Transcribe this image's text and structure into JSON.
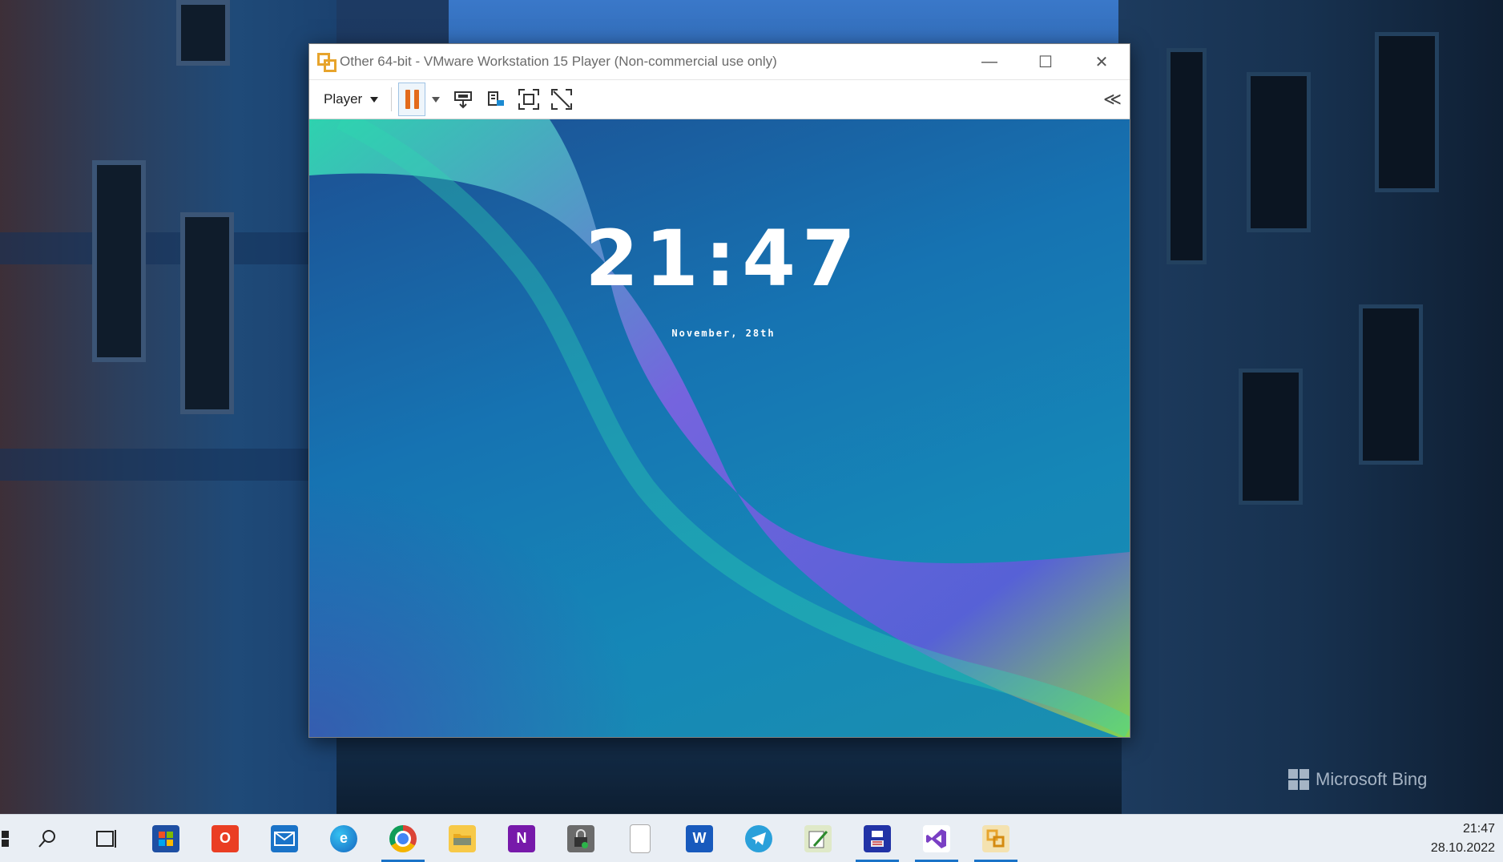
{
  "window": {
    "title": "Other 64-bit - VMware Workstation 15 Player (Non-commercial use only)",
    "controls": {
      "minimize": "—",
      "maximize": "☐",
      "close": "✕"
    }
  },
  "toolbar": {
    "player_label": "Player",
    "collapse_label": "≪",
    "icons": [
      "pause-icon",
      "send-ctrl-alt-del-icon",
      "removable-devices-icon",
      "full-screen-icon",
      "unity-icon"
    ]
  },
  "guest": {
    "clock": "21:47",
    "date": "November, 28th"
  },
  "desktop": {
    "watermark": "Microsoft Bing"
  },
  "taskbar": {
    "apps": [
      {
        "name": "start",
        "icon": "windows-start-icon",
        "active": false
      },
      {
        "name": "search",
        "icon": "search-icon",
        "active": false
      },
      {
        "name": "task-view",
        "icon": "task-view-icon",
        "active": false
      },
      {
        "name": "store",
        "icon": "microsoft-store-icon",
        "active": false
      },
      {
        "name": "office",
        "icon": "office-icon",
        "active": false
      },
      {
        "name": "mail",
        "icon": "mail-icon",
        "active": false
      },
      {
        "name": "edge",
        "icon": "edge-icon",
        "active": false
      },
      {
        "name": "chrome",
        "icon": "chrome-icon",
        "active": true
      },
      {
        "name": "file-explorer",
        "icon": "folder-icon",
        "active": false
      },
      {
        "name": "onenote",
        "icon": "onenote-icon",
        "active": false
      },
      {
        "name": "lock-app",
        "icon": "lock-icon",
        "active": false
      },
      {
        "name": "blank-file",
        "icon": "file-icon",
        "active": false
      },
      {
        "name": "word",
        "icon": "word-icon",
        "active": false
      },
      {
        "name": "telegram",
        "icon": "telegram-icon",
        "active": false
      },
      {
        "name": "editor",
        "icon": "editor-icon",
        "active": false
      },
      {
        "name": "save-app",
        "icon": "floppy-icon",
        "active": true
      },
      {
        "name": "visual-studio",
        "icon": "visual-studio-icon",
        "active": true
      },
      {
        "name": "vmware",
        "icon": "vmware-icon",
        "active": true
      }
    ],
    "time": "21:47",
    "date": "28.10.2022"
  }
}
